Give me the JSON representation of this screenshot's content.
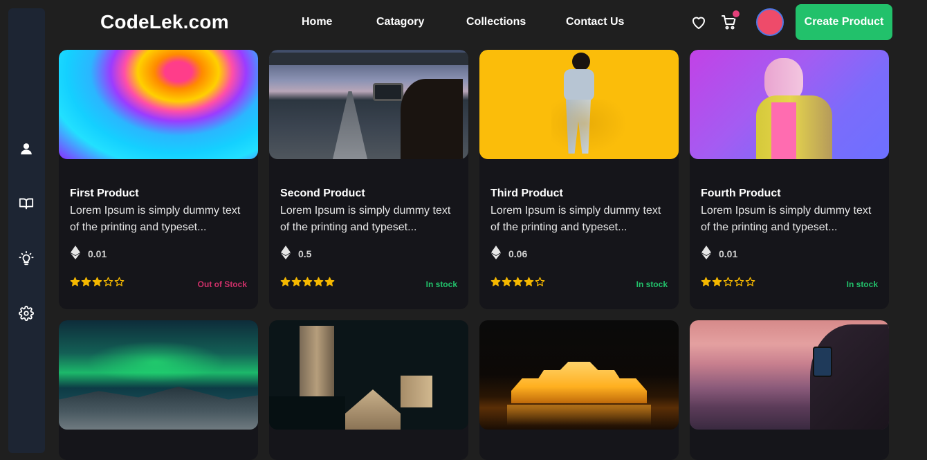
{
  "header": {
    "logo": "CodeLek.com",
    "nav": [
      "Home",
      "Catagory",
      "Collections",
      "Contact Us"
    ],
    "create_button": "Create Product",
    "icons": [
      "heart-icon",
      "cart-icon"
    ]
  },
  "sidebar": {
    "icons": [
      "user-icon",
      "book-icon",
      "lightbulb-icon",
      "settings-icon"
    ]
  },
  "colors": {
    "accent_green": "#22c16b",
    "out_of_stock": "#d0306a",
    "star": "#f5b800",
    "cart_badge": "#e4407a"
  },
  "products": [
    {
      "title": "First Product",
      "description": "Lorem Ipsum is simply dummy text of the printing and typeset...",
      "price": "0.01",
      "rating": 3,
      "stock": "Out of Stock"
    },
    {
      "title": "Second Product",
      "description": "Lorem Ipsum is simply dummy text of the printing and typeset...",
      "price": "0.5",
      "rating": 5,
      "stock": "In stock"
    },
    {
      "title": "Third Product",
      "description": "Lorem Ipsum is simply dummy text of the printing and typeset...",
      "price": "0.06",
      "rating": 4,
      "stock": "In stock"
    },
    {
      "title": "Fourth Product",
      "description": "Lorem Ipsum is simply dummy text of the printing and typeset...",
      "price": "0.01",
      "rating": 2,
      "stock": "In stock"
    }
  ]
}
